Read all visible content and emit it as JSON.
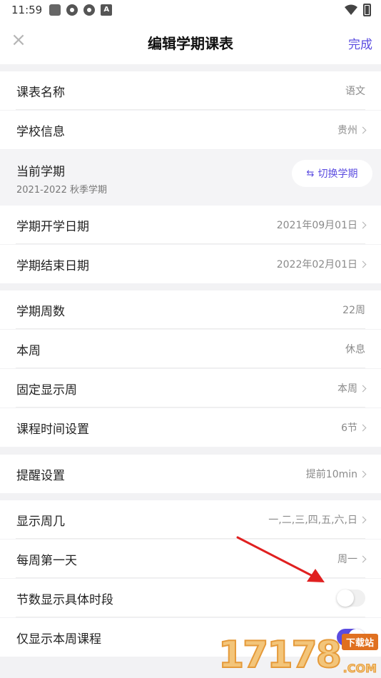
{
  "status_bar": {
    "time": "11:59"
  },
  "nav": {
    "close": "×",
    "title": "编辑学期课表",
    "done": "完成"
  },
  "rows": {
    "course_name": {
      "label": "课表名称",
      "value": "语文"
    },
    "school": {
      "label": "学校信息",
      "value": "贵州"
    },
    "term": {
      "label": "当前学期",
      "sub": "2021-2022 秋季学期",
      "switch_label": "切换学期"
    },
    "start_date": {
      "label": "学期开学日期",
      "value": "2021年09月01日"
    },
    "end_date": {
      "label": "学期结束日期",
      "value": "2022年02月01日"
    },
    "weeks": {
      "label": "学期周数",
      "value": "22周"
    },
    "this_week": {
      "label": "本周",
      "value": "休息"
    },
    "fixed_week": {
      "label": "固定显示周",
      "value": "本周"
    },
    "class_time": {
      "label": "课程时间设置",
      "value": "6节"
    },
    "reminder": {
      "label": "提醒设置",
      "value": "提前10min"
    },
    "weekdays": {
      "label": "显示周几",
      "value": "一,二,三,四,五,六,日"
    },
    "first_day": {
      "label": "每周第一天",
      "value": "周一"
    },
    "show_period": {
      "label": "节数显示具体时段",
      "toggle": false
    },
    "only_this_week": {
      "label": "仅显示本周课程",
      "toggle": true
    }
  },
  "watermark": {
    "number": "17178",
    "badge": "下载站",
    "suffix": ".COM"
  },
  "colors": {
    "accent": "#5b4ce0",
    "arrow": "#e02020"
  }
}
